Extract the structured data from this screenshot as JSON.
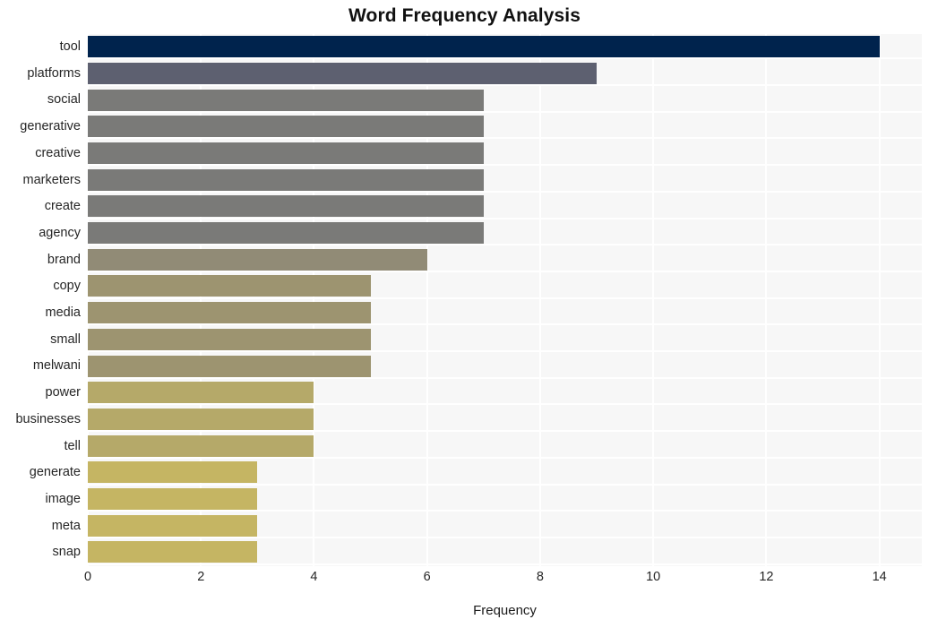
{
  "chart_data": {
    "type": "bar",
    "orientation": "horizontal",
    "title": "Word Frequency Analysis",
    "xlabel": "Frequency",
    "ylabel": "",
    "xlim": [
      0,
      14.75
    ],
    "xticks": [
      0,
      2,
      4,
      6,
      8,
      10,
      12,
      14
    ],
    "xtick_labels": [
      "0",
      "2",
      "4",
      "6",
      "8",
      "10",
      "12",
      "14"
    ],
    "grid": "vertical-only",
    "legend": "none",
    "categories": [
      "tool",
      "platforms",
      "social",
      "generative",
      "creative",
      "marketers",
      "create",
      "agency",
      "brand",
      "copy",
      "media",
      "small",
      "melwani",
      "power",
      "businesses",
      "tell",
      "generate",
      "image",
      "meta",
      "snap"
    ],
    "values": [
      14,
      9,
      7,
      7,
      7,
      7,
      7,
      7,
      6,
      5,
      5,
      5,
      5,
      4,
      4,
      4,
      3,
      3,
      3,
      3
    ],
    "bar_colors": [
      "#00234d",
      "#5d6070",
      "#7a7a78",
      "#7a7a78",
      "#7a7a78",
      "#7a7a78",
      "#7a7a78",
      "#7a7a78",
      "#918b76",
      "#9d9470",
      "#9d9470",
      "#9d9470",
      "#9d9470",
      "#b5a969",
      "#b5a969",
      "#b5a969",
      "#c5b563",
      "#c5b563",
      "#c5b563",
      "#c5b563"
    ]
  },
  "style": {
    "panel_background": "#f7f7f7",
    "gridline_color": "#ffffff",
    "figure_background": "#ffffff",
    "text_color": "#262626"
  }
}
